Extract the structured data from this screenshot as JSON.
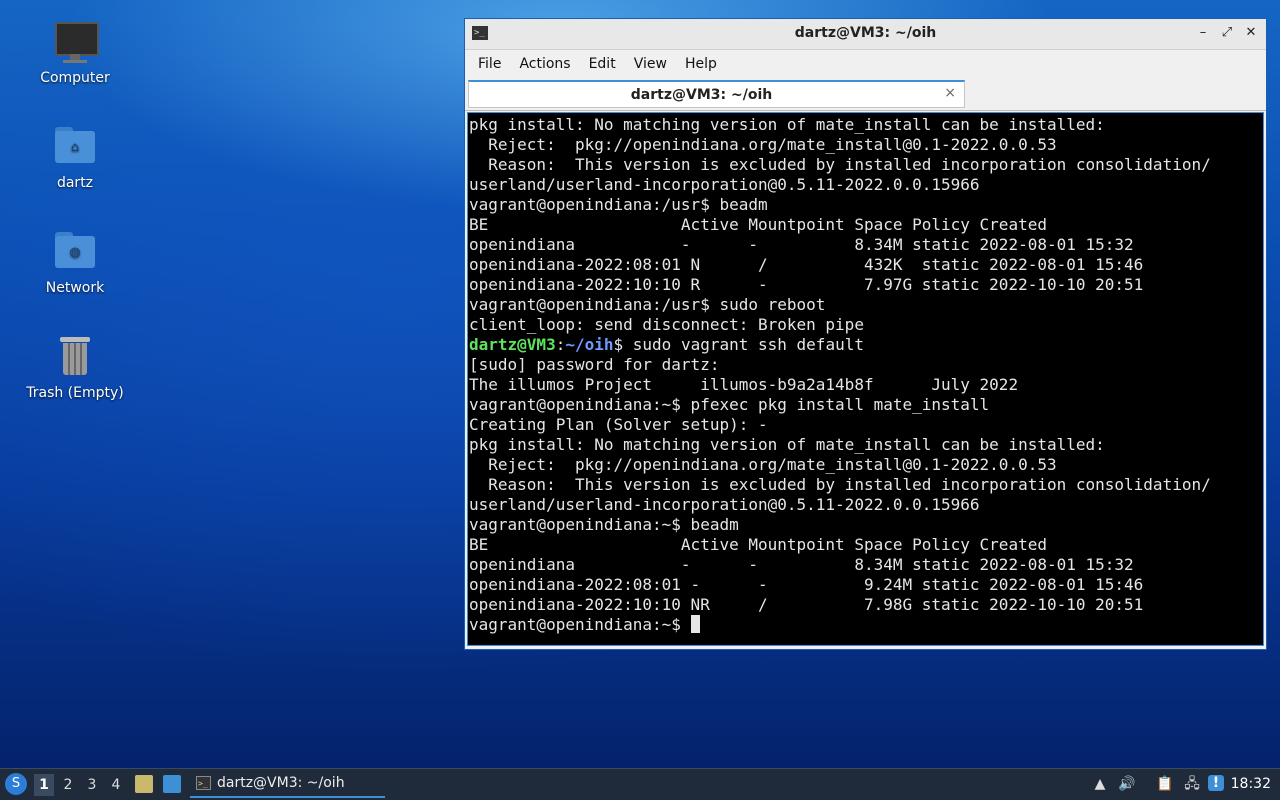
{
  "desktop": {
    "icons": [
      {
        "label": "Computer"
      },
      {
        "label": "dartz"
      },
      {
        "label": "Network"
      },
      {
        "label": "Trash (Empty)"
      }
    ]
  },
  "window": {
    "title": "dartz@VM3: ~/oih",
    "icon_glyph": ">_",
    "controls": {
      "minimize": "–",
      "restore": "⤢",
      "close": "✕"
    },
    "menu": [
      "File",
      "Actions",
      "Edit",
      "View",
      "Help"
    ],
    "tab": {
      "label": "dartz@VM3: ~/oih",
      "close": "×"
    }
  },
  "terminal": {
    "lines": [
      "pkg install: No matching version of mate_install can be installed:",
      "  Reject:  pkg://openindiana.org/mate_install@0.1-2022.0.0.53",
      "  Reason:  This version is excluded by installed incorporation consolidation/",
      "userland/userland-incorporation@0.5.11-2022.0.0.15966",
      "vagrant@openindiana:/usr$ beadm",
      "BE                    Active Mountpoint Space Policy Created",
      "openindiana           -      -          8.34M static 2022-08-01 15:32",
      "openindiana-2022:08:01 N      /          432K  static 2022-08-01 15:46",
      "openindiana-2022:10:10 R      -          7.97G static 2022-10-10 20:51",
      "vagrant@openindiana:/usr$ sudo reboot",
      "client_loop: send disconnect: Broken pipe",
      "",
      "[sudo] password for dartz:",
      "The illumos Project     illumos-b9a2a14b8f      July 2022",
      "vagrant@openindiana:~$ pfexec pkg install mate_install",
      "Creating Plan (Solver setup): -",
      "pkg install: No matching version of mate_install can be installed:",
      "  Reject:  pkg://openindiana.org/mate_install@0.1-2022.0.0.53",
      "  Reason:  This version is excluded by installed incorporation consolidation/",
      "userland/userland-incorporation@0.5.11-2022.0.0.15966",
      "vagrant@openindiana:~$ beadm",
      "BE                    Active Mountpoint Space Policy Created",
      "openindiana           -      -          8.34M static 2022-08-01 15:32",
      "openindiana-2022:08:01 -      -          9.24M static 2022-08-01 15:46",
      "openindiana-2022:10:10 NR     /          7.98G static 2022-10-10 20:51",
      "vagrant@openindiana:~$ "
    ],
    "prompt": {
      "user": "dartz@VM3",
      "sep": ":",
      "path": "~/oih",
      "command": "$ sudo vagrant ssh default"
    }
  },
  "taskbar": {
    "start_glyph": "S",
    "workspaces": [
      "1",
      "2",
      "3",
      "4"
    ],
    "task": {
      "label": "dartz@VM3: ~/oih",
      "icon_glyph": ">_"
    },
    "tray": {
      "up": "▲",
      "volume": "🔊",
      "clipboard": "📋",
      "network": "🖧",
      "updates": "!"
    },
    "clock": "18:32"
  }
}
